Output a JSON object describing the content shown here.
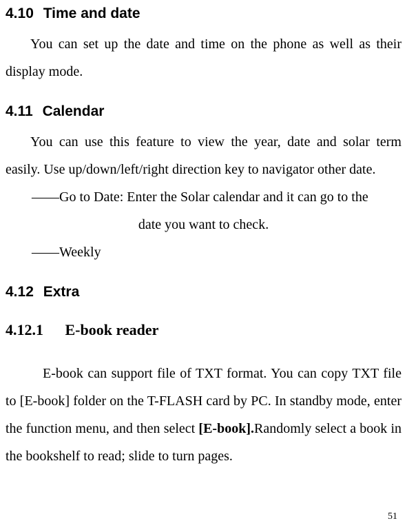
{
  "sections": {
    "s410": {
      "num": "4.10",
      "title": "Time and date",
      "body": "You can set up the date and time on the phone as well as their display mode."
    },
    "s411": {
      "num": "4.11",
      "title": "Calendar",
      "body": "You can use this feature to view the year, date and solar term easily. Use up/down/left/right direction key to navigator other date.",
      "bullet1_line1": "――Go to Date: Enter the Solar calendar and it can go to the",
      "bullet1_line2": "date you want to check.",
      "bullet2": "――Weekly"
    },
    "s412": {
      "num": "4.12",
      "title": "Extra"
    },
    "s4121": {
      "num": "4.12.1",
      "title": "E-book reader",
      "body_before_bold": "E-book can support file of TXT format. You can copy TXT file to [E-book] folder on the T-FLASH card by PC. In standby mode, enter the function menu, and then select ",
      "bold_text": "[E-book].",
      "body_after_bold": "Randomly select a book in the bookshelf to read; slide to turn pages."
    }
  },
  "page_number": "51"
}
